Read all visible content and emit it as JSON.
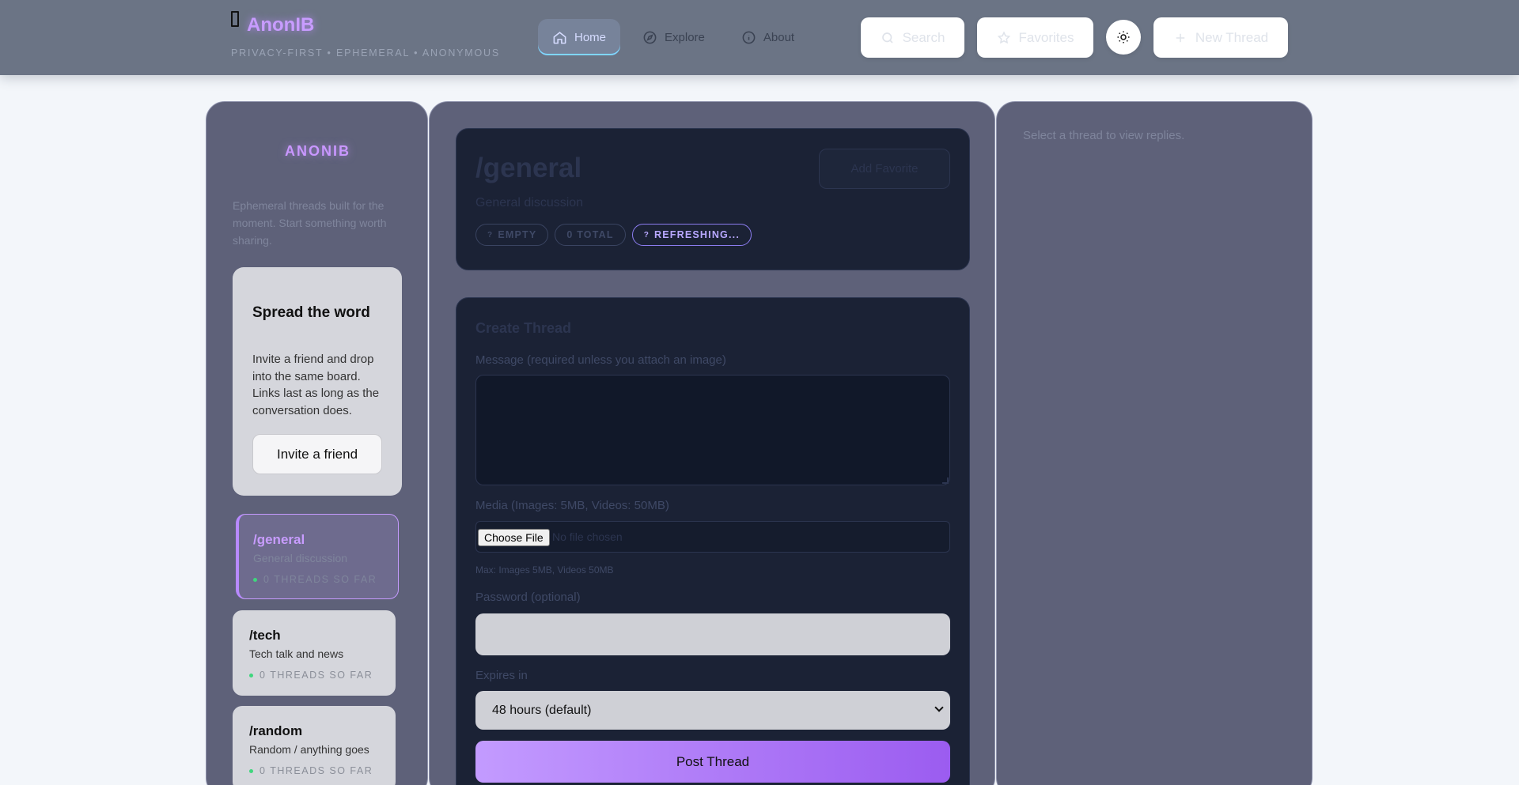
{
  "header": {
    "brand_name": "AnonIB",
    "tagline": "PRIVACY-FIRST • EPHEMERAL • ANONYMOUS",
    "nav": [
      {
        "label": "Home",
        "icon": "home-icon",
        "active": true
      },
      {
        "label": "Explore",
        "icon": "compass-icon",
        "active": false
      },
      {
        "label": "About",
        "icon": "info-icon",
        "active": false
      }
    ],
    "search_label": "Search",
    "favorites_label": "Favorites",
    "new_thread_label": "New Thread"
  },
  "sidebar": {
    "title": "ANONIB",
    "description": "Ephemeral threads built for the moment. Start something worth sharing.",
    "spread": {
      "title": "Spread the word",
      "text": "Invite a friend and drop into the same board. Links last as long as the conversation does.",
      "button": "Invite a friend"
    },
    "boards": [
      {
        "name": "/general",
        "desc": "General discussion",
        "count": "0 THREADS SO FAR",
        "active": true
      },
      {
        "name": "/tech",
        "desc": "Tech talk and news",
        "count": "0 THREADS SO FAR",
        "active": false
      },
      {
        "name": "/random",
        "desc": "Random / anything goes",
        "count": "0 THREADS SO FAR",
        "active": false
      }
    ]
  },
  "board": {
    "title": "/general",
    "description": "General discussion",
    "action_label": "Add Favorite",
    "tags": [
      {
        "glyph": "?",
        "label": "EMPTY"
      },
      {
        "glyph": "",
        "label": "0 TOTAL"
      },
      {
        "glyph": "?",
        "label": "REFRESHING..."
      }
    ]
  },
  "create": {
    "title": "Create Thread",
    "message_label": "Message (required unless you attach an image)",
    "message_value": "",
    "media_label": "Media (Images: 5MB, Videos: 50MB)",
    "file_button": "Choose File",
    "file_status": "No file chosen",
    "media_hint": "Max: Images 5MB, Videos 50MB",
    "password_label": "Password (optional)",
    "password_value": "",
    "expires_label": "Expires in",
    "expires_value": "48 hours (default)",
    "post_label": "Post Thread"
  },
  "replies": {
    "hint": "Select a thread to view replies."
  },
  "colors": {
    "accent": "#c89cff",
    "panel_dark": "#1b2235",
    "column": "#5e6179",
    "status_green": "#3fd67d"
  }
}
